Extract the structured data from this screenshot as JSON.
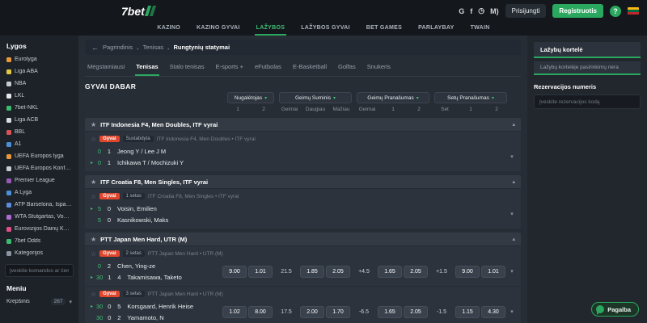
{
  "theme": {
    "accent": "#2aa85f",
    "live": "#e0462c",
    "bg_dark": "#14181d",
    "bg_main": "#272d35"
  },
  "topbar": {
    "logo": "7bet",
    "icons": [
      {
        "name": "google-icon",
        "glyph": "G"
      },
      {
        "name": "facebook-icon",
        "glyph": "f"
      },
      {
        "name": "age-limit-icon",
        "glyph": "◷"
      },
      {
        "name": "regulator-icon",
        "glyph": "M)"
      }
    ],
    "login_label": "Prisijungti",
    "register_label": "Registruotis",
    "help_label": "?",
    "flag_colors": [
      "#FDB913",
      "#006A44",
      "#C1272D"
    ]
  },
  "nav": {
    "items": [
      {
        "label": "KAZINO",
        "active": false
      },
      {
        "label": "KAZINO GYVAI",
        "active": false
      },
      {
        "label": "LAŽYBOS",
        "active": true
      },
      {
        "label": "LAŽYBOS GYVAI",
        "active": false
      },
      {
        "label": "BET GAMES",
        "active": false
      },
      {
        "label": "PARLAYBAY",
        "active": false
      },
      {
        "label": "TWAIN",
        "active": false
      }
    ]
  },
  "sidebar": {
    "title": "Lygos",
    "items": [
      {
        "label": "Eurolyga",
        "color": "#e8973a"
      },
      {
        "label": "Liga ABA",
        "color": "#e3c93f"
      },
      {
        "label": "NBA",
        "color": "#c7ccd1"
      },
      {
        "label": "LKL",
        "color": "#e8e8e8"
      },
      {
        "label": "7bet-NKL",
        "color": "#3dba6e"
      },
      {
        "label": "Liga ACB",
        "color": "#d8dce0"
      },
      {
        "label": "BBL",
        "color": "#d85454"
      },
      {
        "label": "A1",
        "color": "#4a90d9"
      },
      {
        "label": "UEFA Europos lyga",
        "color": "#e8973a"
      },
      {
        "label": "UEFA Europos Konferencijų...",
        "color": "#c7ccd1"
      },
      {
        "label": "Premier League",
        "color": "#9b59b6"
      },
      {
        "label": "A Lyga",
        "color": "#4a90d9"
      },
      {
        "label": "ATP Barselona, Ispanija V...",
        "color": "#5b8dd9"
      },
      {
        "label": "WTA Štutgartas, Vokietija |...",
        "color": "#b06ad4"
      },
      {
        "label": "Eurovizijos Dainų Konkursas",
        "color": "#e04f88"
      },
      {
        "label": "7bet Odds",
        "color": "#3dba6e"
      },
      {
        "label": "Kategorijos",
        "color": "#8a939e"
      }
    ],
    "search_placeholder": "Įveskite komandos ar čemp...",
    "menu_title": "Meniu",
    "menu_items": [
      {
        "label": "Krepšinis",
        "count": "267"
      }
    ]
  },
  "main": {
    "breadcrumb": {
      "home": "Pagrindinis",
      "sport": "Tenisas",
      "current": "Rungtynių statymai"
    },
    "tabs": [
      {
        "label": "Mėgstamiausi",
        "active": false
      },
      {
        "label": "Tenisas",
        "active": true
      },
      {
        "label": "Stalo tenisas",
        "active": false
      },
      {
        "label": "E-sports +",
        "active": false
      },
      {
        "label": "eFutbolas",
        "active": false
      },
      {
        "label": "E-Basketball",
        "active": false
      },
      {
        "label": "Golfas",
        "active": false
      },
      {
        "label": "Snukeris",
        "active": false
      }
    ],
    "section_title": "GYVAI DABAR",
    "markets": [
      {
        "label": "Nugalėtojas",
        "subs": [
          "1",
          "2"
        ]
      },
      {
        "label": "Geimų Suminis",
        "subs": [
          "Geimai",
          "Daugiau",
          "Mažiau"
        ]
      },
      {
        "label": "Geimų Pranašumas",
        "subs": [
          "Geimai",
          "1",
          "2"
        ]
      },
      {
        "label": "Setų Pranašumas",
        "subs": [
          "Set",
          "1",
          "2"
        ]
      }
    ],
    "groups": [
      {
        "title": "ITF Indonesia F4, Men Doubles, ITF vyrai",
        "matches": [
          {
            "live_label": "Gyvai",
            "status": "Sustabdyta",
            "league": "ITF Indonesia F4, Men Doubles • ITF vyrai",
            "rows": [
              {
                "scores": [
                  "0",
                  "1"
                ],
                "name": "Jeong Y / Lee J M",
                "serving": false
              },
              {
                "scores": [
                  "0",
                  "1"
                ],
                "name": "Ichikawa T / Mochizuki Y",
                "serving": true
              }
            ],
            "odds": []
          }
        ]
      },
      {
        "title": "ITF Croatia F8, Men Singles, ITF vyrai",
        "matches": [
          {
            "live_label": "Gyvai",
            "status": "1 setas",
            "league": "ITF Croatia F8, Men Singles • ITF vyrai",
            "rows": [
              {
                "scores": [
                  "5",
                  "0"
                ],
                "name": "Voisin, Emilien",
                "serving": true
              },
              {
                "scores": [
                  "5",
                  "0"
                ],
                "name": "Kasnikowski, Maks",
                "serving": false
              }
            ],
            "odds": []
          }
        ]
      },
      {
        "title": "PTT Japan Men Hard, UTR (M)",
        "matches": [
          {
            "live_label": "Gyvai",
            "status": "2 setas",
            "league": "PTT Japan Men Hard • UTR (M)",
            "rows": [
              {
                "scores": [
                  "0",
                  "2"
                ],
                "name": "Chen, Ying-ze",
                "serving": false
              },
              {
                "scores": [
                  "30",
                  "1",
                  "4"
                ],
                "name": "Takamisawa, Taketo",
                "serving": true
              }
            ],
            "odds": [
              {
                "line": null,
                "values": [
                  "9.00",
                  "1.01"
                ]
              },
              {
                "line": "21.5",
                "values": [
                  "1.85",
                  "2.05"
                ]
              },
              {
                "line": "+4.5",
                "values": [
                  "1.65",
                  "2.05"
                ]
              },
              {
                "line": "+1.5",
                "values": [
                  "9.00",
                  "1.01"
                ]
              }
            ]
          },
          {
            "live_label": "Gyvai",
            "status": "3 setas",
            "league": "PTT Japan Men Hard • UTR (M)",
            "rows": [
              {
                "scores": [
                  "30",
                  "0",
                  "5"
                ],
                "name": "Korsgaard, Henrik Heise",
                "serving": true
              },
              {
                "scores": [
                  "30",
                  "0",
                  "2"
                ],
                "name": "Yamamoto, N",
                "serving": false
              }
            ],
            "odds": [
              {
                "line": null,
                "values": [
                  "1.02",
                  "8.00"
                ]
              },
              {
                "line": "17.5",
                "values": [
                  "2.00",
                  "1.70"
                ]
              },
              {
                "line": "-6.5",
                "values": [
                  "1.65",
                  "2.05"
                ]
              },
              {
                "line": "-1.5",
                "values": [
                  "1.15",
                  "4.30"
                ]
              }
            ]
          }
        ]
      }
    ]
  },
  "betslip": {
    "tab_label": "Lažybų kortelė",
    "empty_message": "Lažybų kortelėje pasirinkimų nėra",
    "reservation_title": "Rezervacijos numeris",
    "reservation_placeholder": "Įveskite rezervacijos kodą"
  },
  "help_button": {
    "label": "Pagalba"
  }
}
